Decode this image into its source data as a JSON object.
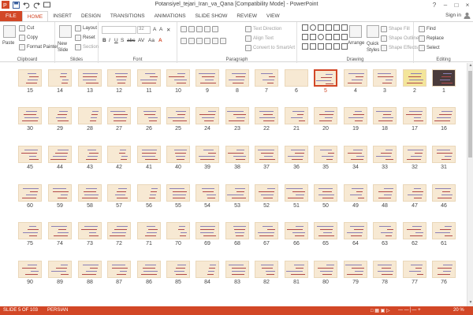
{
  "window": {
    "title": "Potansiyel_tejari_Iran_va_Qana [Compatibility Mode] - PowerPoint",
    "controls": [
      "?",
      "–",
      "□",
      "×"
    ]
  },
  "tabs": [
    "FILE",
    "HOME",
    "INSERT",
    "DESIGN",
    "TRANSITIONS",
    "ANIMATIONS",
    "SLIDE SHOW",
    "REVIEW",
    "VIEW"
  ],
  "signin": "Sign in",
  "ribbon": {
    "clipboard": {
      "label": "Clipboard",
      "paste": "Paste",
      "cut": "Cut",
      "copy": "Copy",
      "format_painter": "Format Painter"
    },
    "slides": {
      "label": "Slides",
      "new_slide": "New Slide",
      "layout": "Layout",
      "reset": "Reset",
      "section": "Section"
    },
    "font": {
      "label": "Font",
      "font_name": "",
      "font_size": "32",
      "buttons": [
        "B",
        "I",
        "U",
        "S",
        "abc",
        "AV",
        "Aa",
        "A"
      ]
    },
    "paragraph": {
      "label": "Paragraph",
      "text_direction": "Text Direction",
      "align_text": "Align Text",
      "convert_smartart": "Convert to SmartArt"
    },
    "drawing": {
      "label": "Drawing",
      "arrange": "Arrange",
      "quick_styles": "Quick Styles",
      "shape_fill": "Shape Fill",
      "shape_outline": "Shape Outline",
      "shape_effects": "Shape Effects"
    },
    "editing": {
      "label": "Editing",
      "find": "Find",
      "replace": "Replace",
      "select": "Select"
    }
  },
  "slides": {
    "rows": [
      [
        "15",
        "14",
        "13",
        "12",
        "11",
        "10",
        "9",
        "8",
        "7",
        "6",
        "5",
        "4",
        "3",
        "2",
        "1"
      ],
      [
        "30",
        "29",
        "28",
        "27",
        "26",
        "25",
        "24",
        "23",
        "22",
        "21",
        "20",
        "19",
        "18",
        "17",
        "16"
      ],
      [
        "45",
        "44",
        "43",
        "42",
        "41",
        "40",
        "39",
        "38",
        "37",
        "36",
        "35",
        "34",
        "33",
        "32",
        "31"
      ],
      [
        "60",
        "59",
        "58",
        "57",
        "56",
        "55",
        "54",
        "53",
        "52",
        "51",
        "50",
        "49",
        "48",
        "47",
        "46"
      ],
      [
        "75",
        "74",
        "73",
        "72",
        "71",
        "70",
        "69",
        "68",
        "67",
        "66",
        "65",
        "64",
        "63",
        "62",
        "61"
      ],
      [
        "90",
        "89",
        "88",
        "87",
        "86",
        "85",
        "84",
        "83",
        "82",
        "81",
        "80",
        "79",
        "78",
        "77",
        "76"
      ]
    ],
    "selected": "5"
  },
  "status": {
    "slide_info": "SLIDE 5 OF 103",
    "language": "PERSIAN",
    "zoom": "20 %"
  },
  "colors": {
    "accent": "#d24726",
    "thumb_bg": "#f7e9d3"
  }
}
